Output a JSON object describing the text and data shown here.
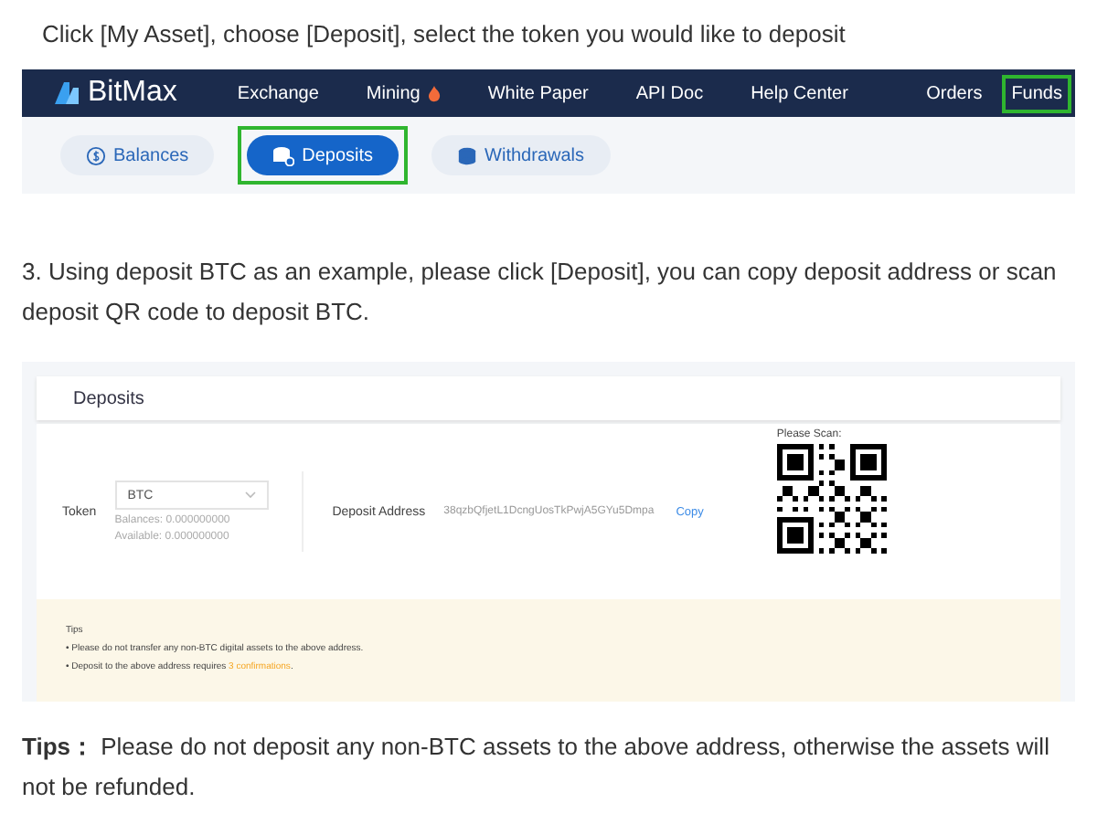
{
  "intro": "Click [My Asset], choose [Deposit], select the token you would like to deposit",
  "navbar": {
    "logo": "BitMax",
    "links": [
      {
        "label": "Exchange",
        "hot": false
      },
      {
        "label": "Mining",
        "hot": true
      },
      {
        "label": "White Paper",
        "hot": false
      },
      {
        "label": "API Doc",
        "hot": false
      },
      {
        "label": "Help Center",
        "hot": false
      }
    ],
    "right_links": [
      {
        "label": "Orders",
        "highlighted": false
      },
      {
        "label": "Funds",
        "highlighted": true
      }
    ]
  },
  "tabs": [
    {
      "label": "Balances",
      "kind": "coin",
      "selected": false,
      "highlighted": false
    },
    {
      "label": "Deposits",
      "kind": "deposit",
      "selected": true,
      "highlighted": true
    },
    {
      "label": "Withdrawals",
      "kind": "stack",
      "selected": false,
      "highlighted": false
    }
  ],
  "step": "3. Using deposit BTC as an example, please click [Deposit], you can copy deposit address or scan deposit QR code to deposit BTC.",
  "deposit_panel": {
    "title": "Deposits",
    "token_label": "Token",
    "token_value": "BTC",
    "balances": "Balances: 0.000000000",
    "available": "Available: 0.000000000",
    "address_label": "Deposit Address",
    "address": "38qzbQfjetL1DcngUosTkPwjA5GYu5Dmpa",
    "copy": "Copy",
    "scan_label": "Please Scan:",
    "tips_title": "Tips",
    "tips": [
      {
        "text": "• Please do not transfer any non-BTC digital assets to the above address."
      },
      {
        "text": "• Deposit to the above address requires ",
        "link": "3 confirmations",
        "after": "."
      }
    ]
  },
  "note": "**Tips：** Please do not deposit any non-BTC assets to the above address, otherwise the assets will not be refunded."
}
